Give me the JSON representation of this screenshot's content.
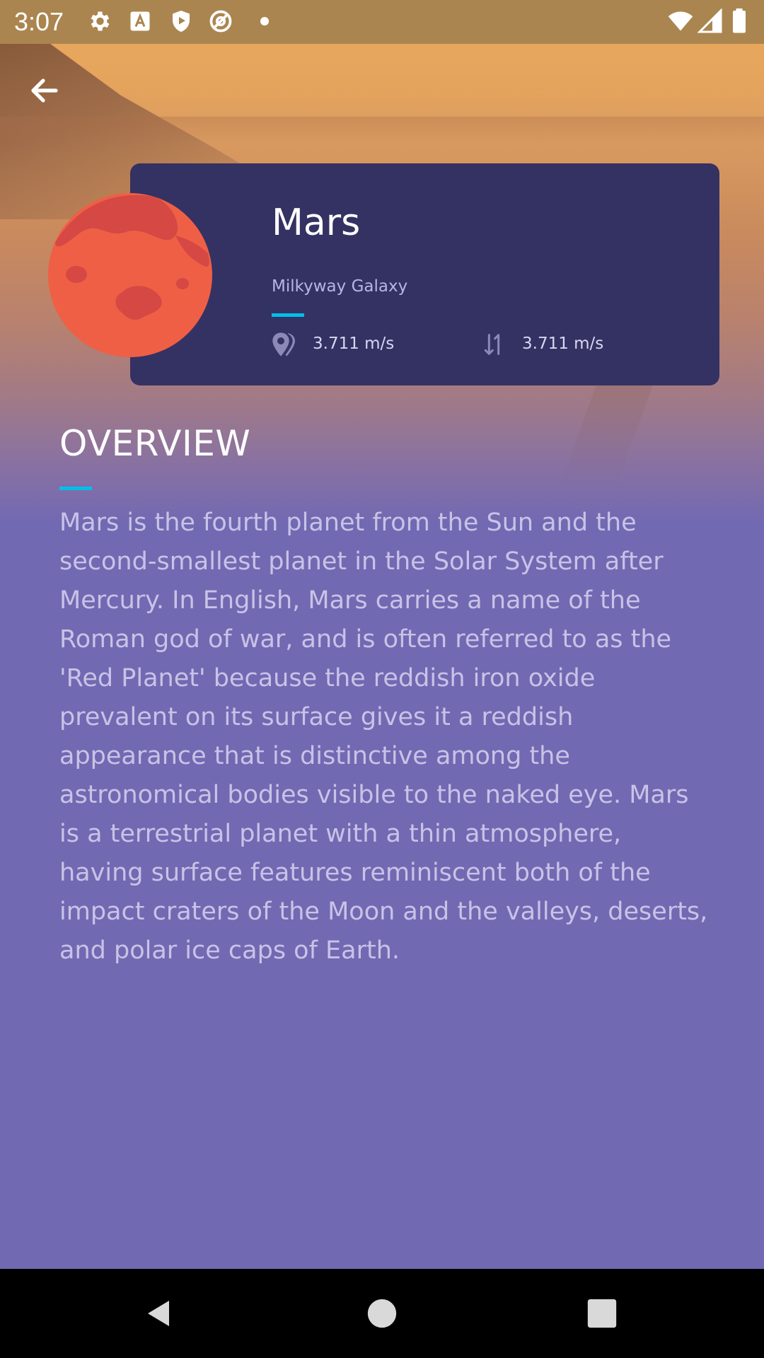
{
  "status_bar": {
    "time": "3:07",
    "icons_left": [
      "gear-icon",
      "a-text-icon",
      "shield-play-icon",
      "at-sign-icon",
      "dot-icon"
    ],
    "icons_right": [
      "wifi-icon",
      "signal-icon",
      "battery-icon"
    ]
  },
  "header": {
    "back_icon": "arrow-left-icon"
  },
  "planet": {
    "name": "Mars",
    "galaxy": "Milkyway Galaxy",
    "stats": [
      {
        "icon": "map-pin-icon",
        "value": "3.711 m/s"
      },
      {
        "icon": "gravity-arrows-icon",
        "value": "3.711 m/s"
      }
    ],
    "color": "#ef5f45",
    "shade_color": "#d54843"
  },
  "overview": {
    "title": "OVERVIEW",
    "body": "Mars is the fourth planet from the Sun and the second-smallest planet in the Solar System after Mercury. In English, Mars carries a name of the Roman god of war, and is often referred to as the 'Red Planet' because the reddish iron oxide prevalent on its surface gives it a reddish appearance that is distinctive among the astronomical bodies visible to the naked eye. Mars is a terrestrial planet with a thin atmosphere, having surface features reminiscent both of the impact craters of the Moon and the valleys, deserts, and polar ice caps of Earth."
  },
  "colors": {
    "accent": "#00bfe8",
    "card": "#343263",
    "background": "#7269b3"
  },
  "nav_bar": {
    "buttons": [
      "back-triangle-icon",
      "home-circle-icon",
      "recents-square-icon"
    ]
  }
}
